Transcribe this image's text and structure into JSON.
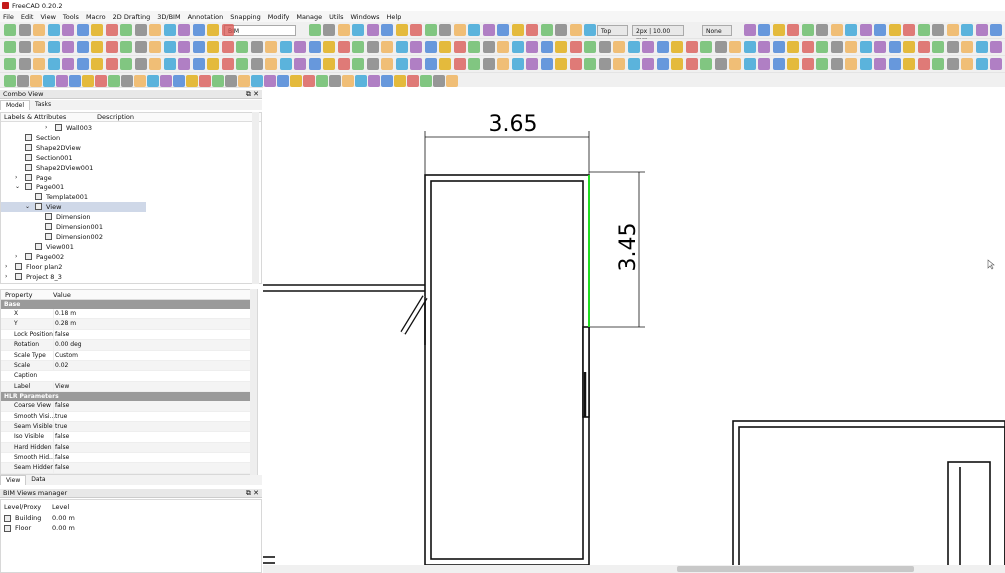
{
  "window": {
    "title": "FreeCAD 0.20.2"
  },
  "menu": [
    "File",
    "Edit",
    "View",
    "Tools",
    "Macro",
    "2D Drafting",
    "3D/BIM",
    "Annotation",
    "Snapping",
    "Modify",
    "Manage",
    "Utils",
    "Windows",
    "Help"
  ],
  "toolbar": {
    "workbench": "BIM",
    "view_combo": "Top",
    "line_combo": "2px | 10.00 mm",
    "snap_combo": "None"
  },
  "combo_view": {
    "title": "Combo View",
    "tabs": [
      "Model",
      "Tasks"
    ],
    "tree_headers": [
      "Labels & Attributes",
      "Description"
    ],
    "tree_items": [
      {
        "label": "Wall003",
        "indent": 5,
        "expander": ">"
      },
      {
        "label": "Section",
        "indent": 2,
        "expander": ""
      },
      {
        "label": "Shape2DView",
        "indent": 2,
        "expander": ""
      },
      {
        "label": "Section001",
        "indent": 2,
        "expander": ""
      },
      {
        "label": "Shape2DView001",
        "indent": 2,
        "expander": ""
      },
      {
        "label": "Page",
        "indent": 2,
        "expander": ">"
      },
      {
        "label": "Page001",
        "indent": 2,
        "expander": "v"
      },
      {
        "label": "Template001",
        "indent": 3,
        "expander": ""
      },
      {
        "label": "View",
        "indent": 3,
        "expander": "v",
        "selected": true
      },
      {
        "label": "Dimension",
        "indent": 4,
        "expander": ""
      },
      {
        "label": "Dimension001",
        "indent": 4,
        "expander": ""
      },
      {
        "label": "Dimension002",
        "indent": 4,
        "expander": ""
      },
      {
        "label": "View001",
        "indent": 3,
        "expander": ""
      },
      {
        "label": "Page002",
        "indent": 2,
        "expander": ">"
      },
      {
        "label": "Floor plan2",
        "indent": 1,
        "expander": ">"
      },
      {
        "label": "Project 8_3",
        "indent": 1,
        "expander": ">"
      }
    ],
    "prop_headers": [
      "Property",
      "Value"
    ],
    "groups": [
      {
        "name": "Base",
        "rows": [
          {
            "k": "X",
            "v": "0.18 m"
          },
          {
            "k": "Y",
            "v": "0.28 m"
          },
          {
            "k": "Lock Position",
            "v": "false"
          },
          {
            "k": "Rotation",
            "v": "0.00 deg"
          },
          {
            "k": "Scale Type",
            "v": "Custom"
          },
          {
            "k": "Scale",
            "v": "0.02"
          },
          {
            "k": "Caption",
            "v": ""
          },
          {
            "k": "Label",
            "v": "View"
          }
        ]
      },
      {
        "name": "HLR Parameters",
        "rows": [
          {
            "k": "Coarse View",
            "v": "false"
          },
          {
            "k": "Smooth Visi...",
            "v": "true"
          },
          {
            "k": "Seam Visible",
            "v": "true"
          },
          {
            "k": "Iso Visible",
            "v": "false"
          },
          {
            "k": "Hard Hidden",
            "v": "false"
          },
          {
            "k": "Smooth Hid...",
            "v": "false"
          },
          {
            "k": "Seam Hidden",
            "v": "false"
          }
        ]
      }
    ],
    "bottom_tabs": [
      "View",
      "Data"
    ]
  },
  "bim_views": {
    "title": "BIM Views manager",
    "headers": [
      "Level/Proxy",
      "Level"
    ],
    "rows": [
      {
        "name": "Building",
        "level": "0.00 m"
      },
      {
        "name": "Floor",
        "level": "0.00 m"
      }
    ]
  },
  "drawing": {
    "dim_horizontal": "3.65",
    "dim_vertical": "3.45"
  },
  "colors": {
    "selection_green": "#22dd22",
    "panel_group": "#9a9a9a",
    "tree_selection": "#cfd8e8"
  }
}
